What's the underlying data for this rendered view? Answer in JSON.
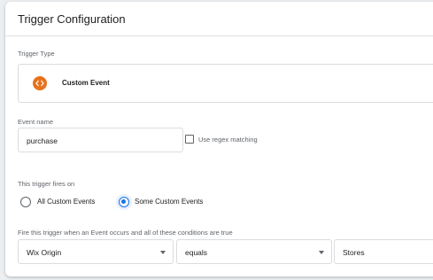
{
  "header": {
    "title": "Trigger Configuration"
  },
  "trigger_type": {
    "label": "Trigger Type",
    "selected": "Custom Event",
    "icon": "code-icon",
    "icon_color": "#e8711c"
  },
  "event_name": {
    "label": "Event name",
    "value": "purchase",
    "regex_label": "Use regex matching",
    "regex_checked": false
  },
  "fires_on": {
    "label": "This trigger fires on",
    "options": [
      {
        "label": "All Custom Events",
        "selected": false
      },
      {
        "label": "Some Custom Events",
        "selected": true
      }
    ],
    "accent_color": "#1a73e8"
  },
  "conditions": {
    "label": "Fire this trigger when an Event occurs and all of these conditions are true",
    "variable": "Wix Origin",
    "operator": "equals",
    "value": "Stores"
  }
}
